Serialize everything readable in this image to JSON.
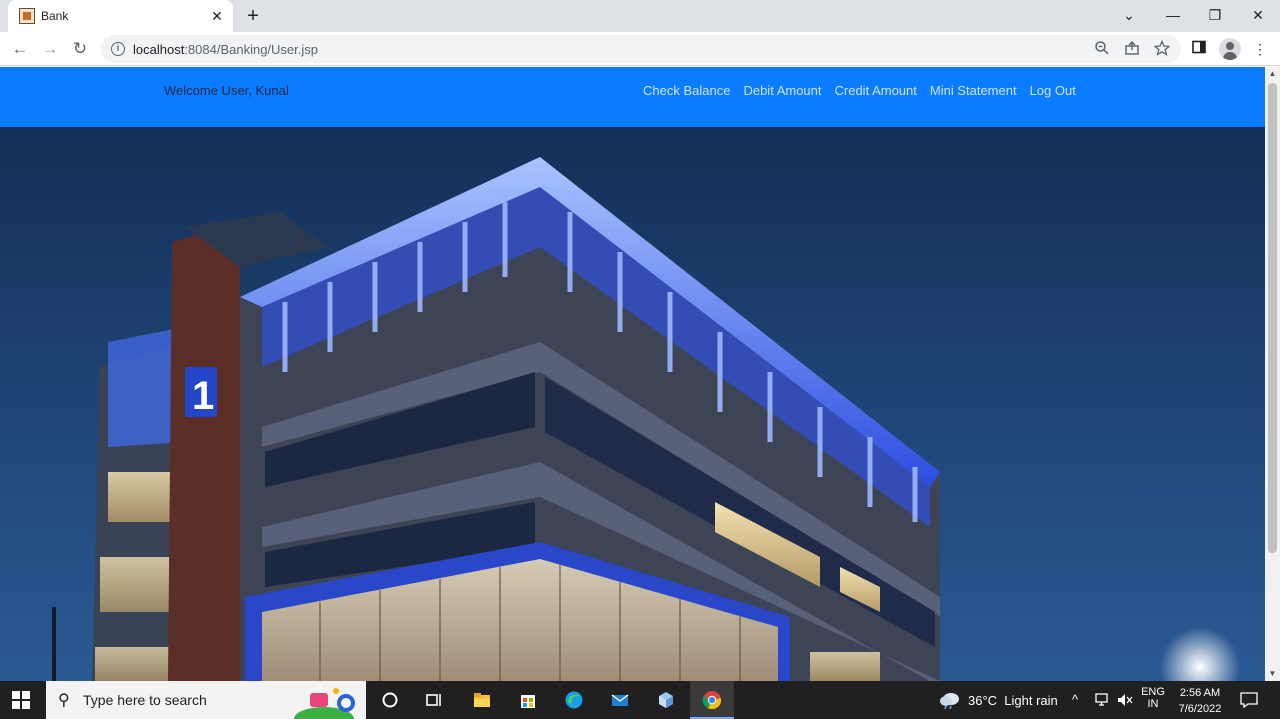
{
  "browser": {
    "tab_title": "Bank",
    "tab_close": "✕",
    "new_tab": "+",
    "url_host": "localhost",
    "url_path": ":8084/Banking/User.jsp",
    "window_controls": {
      "dropdown": "⌄",
      "minimize": "—",
      "restore": "❐",
      "close": "✕"
    },
    "icons": [
      "back-icon",
      "forward-icon",
      "reload-icon",
      "info-icon",
      "zoom-icon",
      "share-icon",
      "star-icon",
      "sidepanel-icon",
      "profile-icon",
      "menu-icon"
    ]
  },
  "page": {
    "welcome": "Welcome User, Kunal",
    "nav": {
      "check_balance": "Check Balance",
      "debit_amount": "Debit Amount",
      "credit_amount": "Credit Amount",
      "mini_statement": "Mini Statement",
      "log_out": "Log Out"
    },
    "colors": {
      "navbar": "#0b7bff",
      "sky": "#1d3f6e",
      "accent_light": "#5f8dff"
    },
    "hero_sign": "1"
  },
  "taskbar": {
    "search_placeholder": "Type here to search",
    "weather_temp": "36°C",
    "weather_desc": "Light rain",
    "lang_top": "ENG",
    "lang_bottom": "IN",
    "time": "2:56 AM",
    "date": "7/6/2022"
  }
}
